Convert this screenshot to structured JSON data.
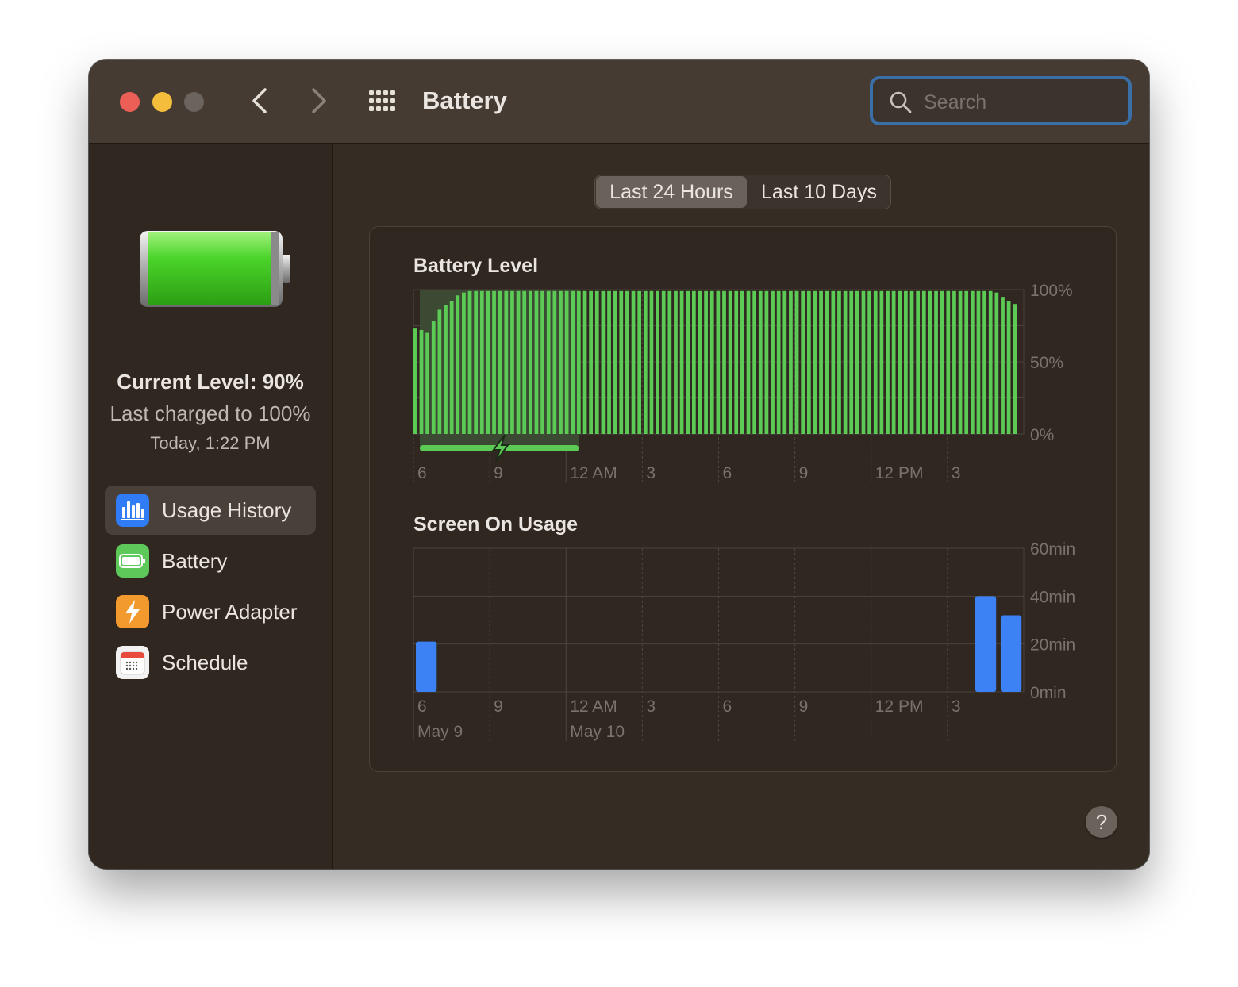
{
  "window": {
    "title": "Battery",
    "search_placeholder": "Search"
  },
  "sidebar": {
    "current_level": "Current Level: 90%",
    "last_charged": "Last charged to 100%",
    "charged_time": "Today, 1:22 PM",
    "items": [
      {
        "label": "Usage History",
        "icon": "bar-chart-icon",
        "selected": true,
        "color": "#2f7cf6"
      },
      {
        "label": "Battery",
        "icon": "battery-icon",
        "selected": false,
        "color": "#5fc85a"
      },
      {
        "label": "Power Adapter",
        "icon": "bolt-icon",
        "selected": false,
        "color": "#f29a2e"
      },
      {
        "label": "Schedule",
        "icon": "calendar-icon",
        "selected": false,
        "color": "#ffffff"
      }
    ]
  },
  "tabs": [
    {
      "label": "Last 24 Hours",
      "active": true
    },
    {
      "label": "Last 10 Days",
      "active": false
    }
  ],
  "colors": {
    "battery_green": "#5ccb55",
    "usage_blue": "#3d82f5"
  },
  "chart_data": [
    {
      "type": "bar",
      "title": "Battery Level",
      "y_ticks": [
        "100%",
        "50%",
        "0%"
      ],
      "ylim": [
        0,
        100
      ],
      "x_tick_labels": [
        "6",
        "9",
        "12 AM",
        "3",
        "6",
        "9",
        "12 PM",
        "3"
      ],
      "charging_interval_hours": [
        0.25,
        6.5
      ],
      "values": [
        73,
        72,
        70,
        78,
        86,
        89,
        92,
        96,
        98,
        99,
        99,
        99,
        99,
        99,
        99,
        99,
        99,
        99,
        99,
        99,
        99,
        99,
        99,
        99,
        99,
        99,
        99,
        99,
        99,
        99,
        99,
        99,
        99,
        99,
        99,
        99,
        99,
        99,
        99,
        99,
        99,
        99,
        99,
        99,
        99,
        99,
        99,
        99,
        99,
        99,
        99,
        99,
        99,
        99,
        99,
        99,
        99,
        99,
        99,
        99,
        99,
        99,
        99,
        99,
        99,
        99,
        99,
        99,
        99,
        99,
        99,
        99,
        99,
        99,
        99,
        99,
        99,
        99,
        99,
        99,
        99,
        99,
        99,
        99,
        99,
        99,
        99,
        99,
        99,
        99,
        99,
        99,
        99,
        99,
        99,
        99,
        98,
        95,
        92,
        90
      ]
    },
    {
      "type": "bar",
      "title": "Screen On Usage",
      "y_ticks": [
        "60min",
        "40min",
        "20min",
        "0min"
      ],
      "ylim": [
        0,
        60
      ],
      "x_tick_labels": [
        "6",
        "9",
        "12 AM",
        "3",
        "6",
        "9",
        "12 PM",
        "3"
      ],
      "date_labels": [
        "May 9",
        "May 10"
      ],
      "values": [
        21,
        0,
        0,
        0,
        0,
        0,
        0,
        0,
        0,
        0,
        0,
        0,
        0,
        0,
        0,
        0,
        0,
        0,
        0,
        0,
        0,
        0,
        40,
        32
      ]
    }
  ],
  "help_label": "?"
}
